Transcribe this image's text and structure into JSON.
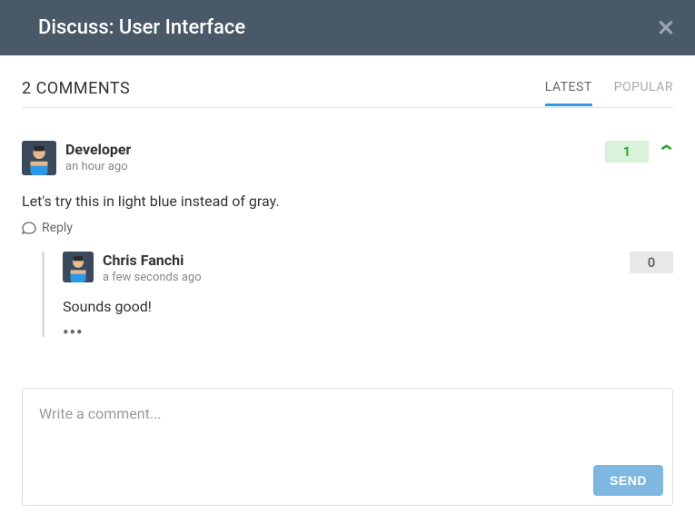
{
  "header": {
    "title": "Discuss: User Interface"
  },
  "tabs": {
    "count_text": "2 COMMENTS",
    "latest": "LATEST",
    "popular": "POPULAR"
  },
  "comments": [
    {
      "author": "Developer",
      "time": "an hour ago",
      "body": "Let's try this in light blue instead of gray.",
      "score": "1",
      "reply_label": "Reply",
      "replies": [
        {
          "author": "Chris Fanchi",
          "time": "a few seconds ago",
          "body": "Sounds good!",
          "score": "0"
        }
      ]
    }
  ],
  "composer": {
    "placeholder": "Write a comment...",
    "send_label": "SEND"
  }
}
